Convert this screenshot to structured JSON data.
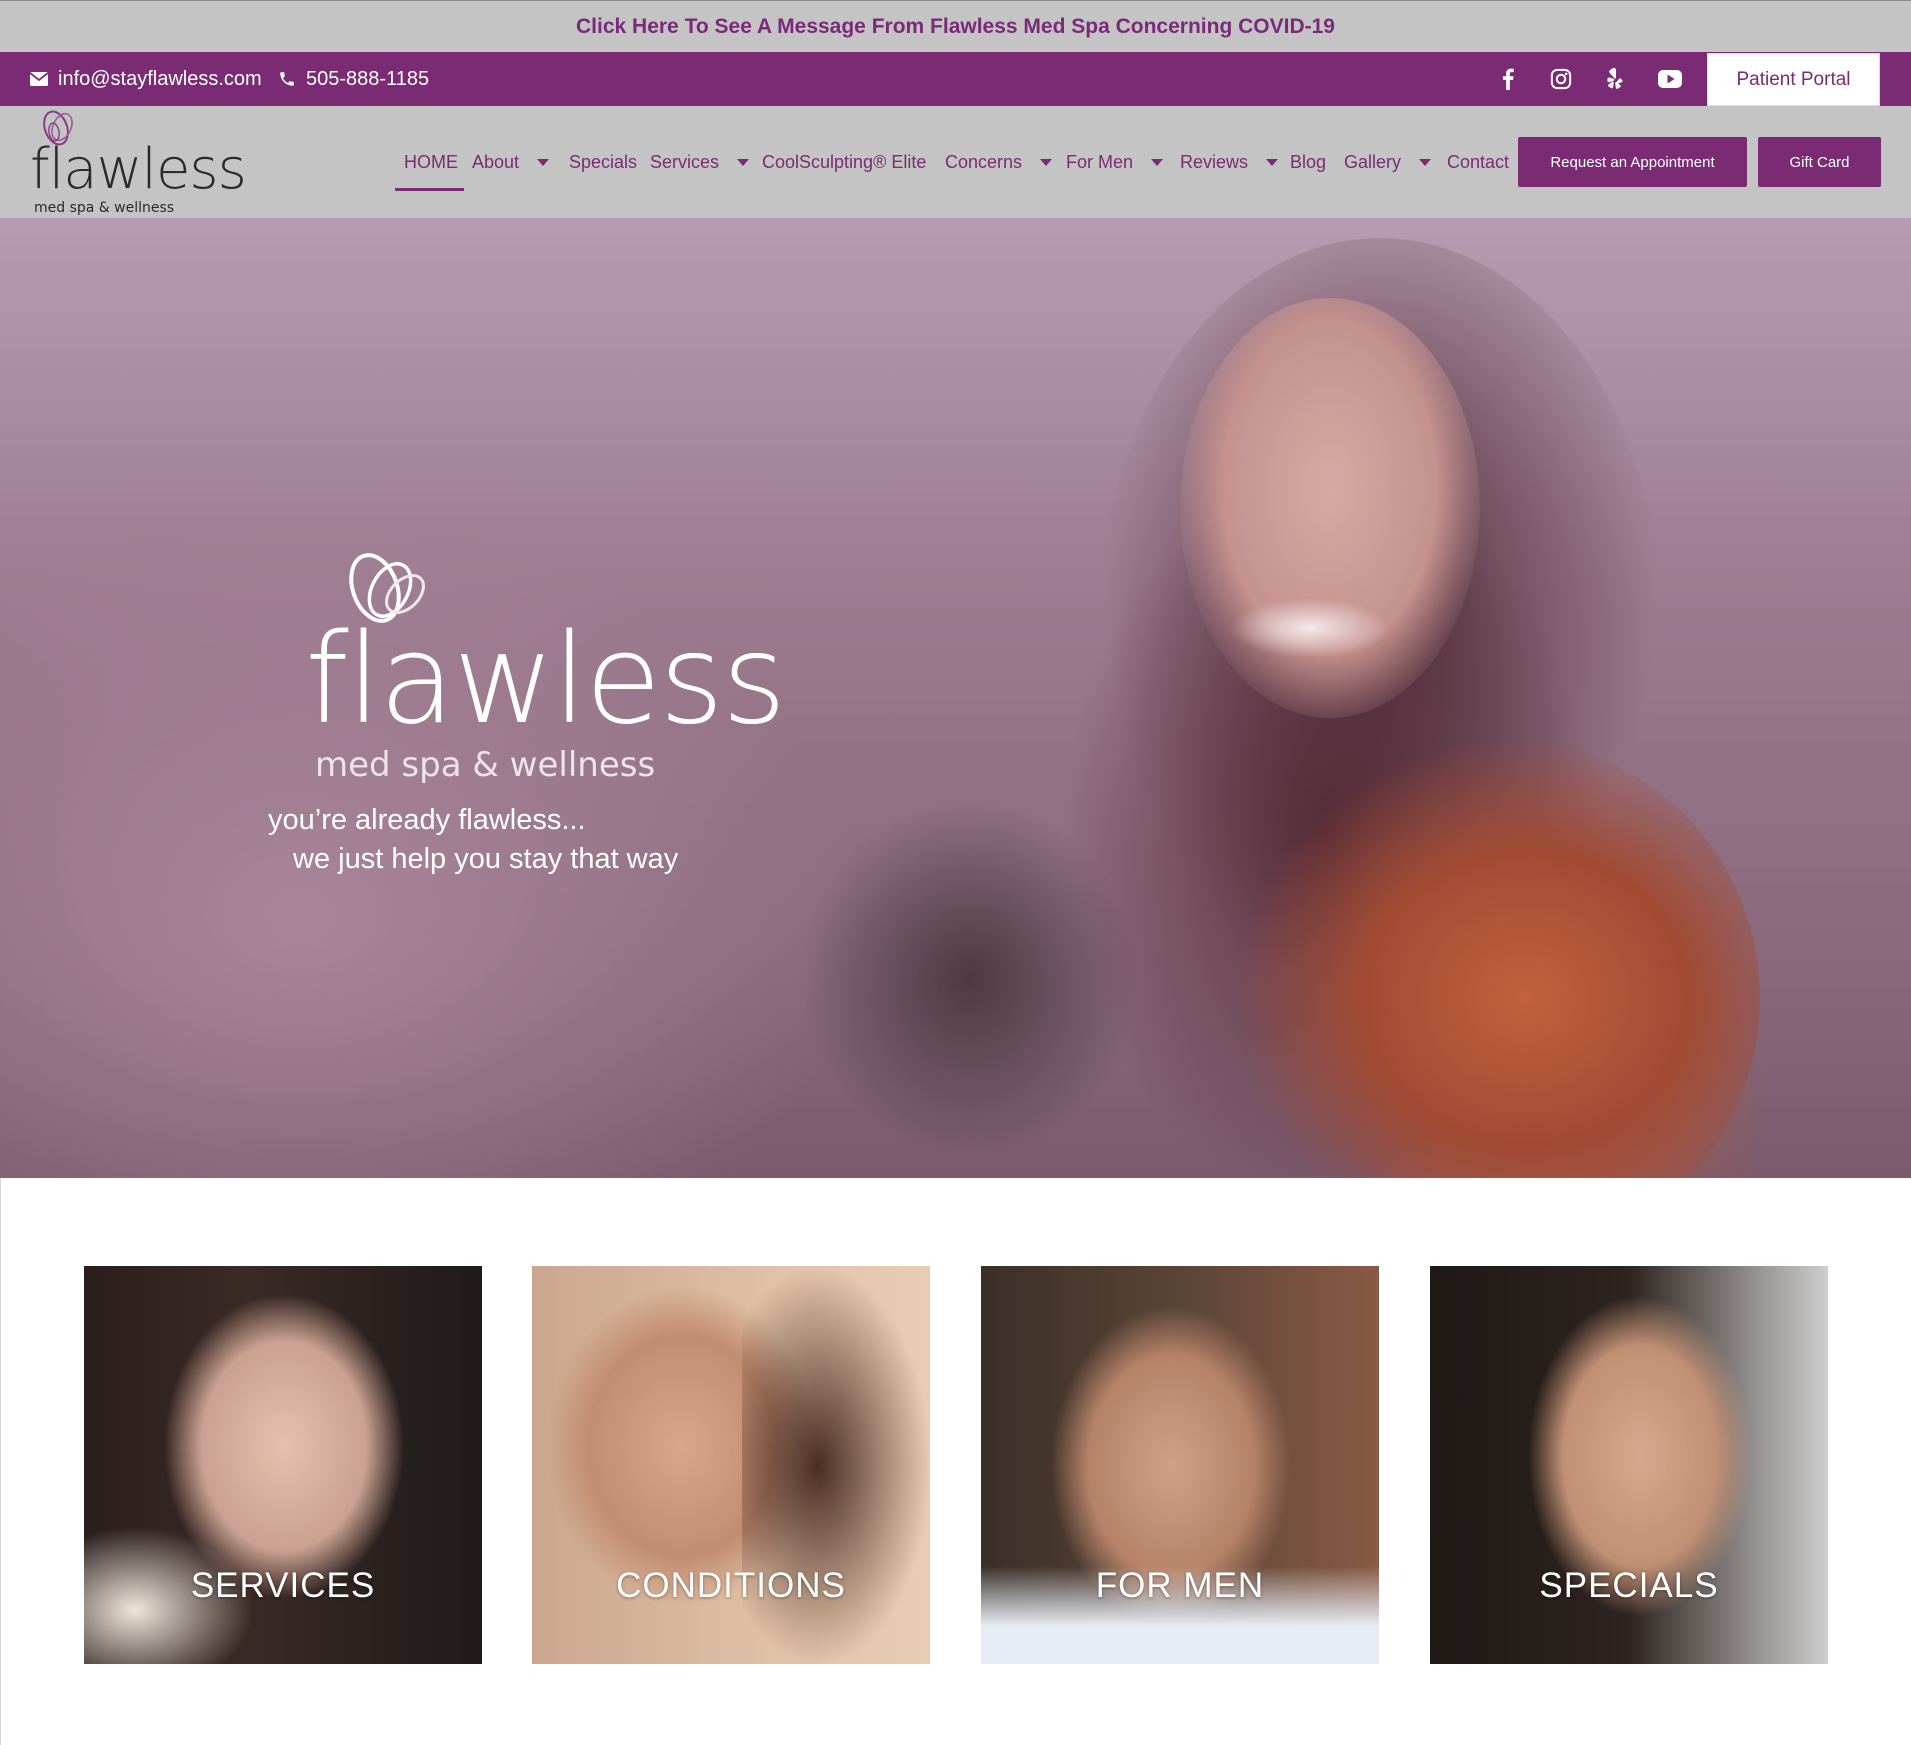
{
  "covid_banner": {
    "text": "Click Here To See A Message From Flawless Med Spa Concerning COVID-19"
  },
  "contact": {
    "email": "info@stayflawless.com",
    "phone": "505-888-1185",
    "email_icon": "envelope-icon",
    "phone_icon": "phone-icon"
  },
  "social": [
    {
      "name": "facebook-icon"
    },
    {
      "name": "instagram-icon"
    },
    {
      "name": "yelp-icon"
    },
    {
      "name": "youtube-icon"
    }
  ],
  "patient_portal": {
    "label": "Patient Portal"
  },
  "logo": {
    "word": "flawless",
    "sub": "med spa & wellness"
  },
  "nav": {
    "items": [
      {
        "label": "HOME",
        "active": true
      },
      {
        "label": "About",
        "dropdown": true
      },
      {
        "label": "Specials"
      },
      {
        "label": "Services",
        "dropdown": true
      },
      {
        "label": "CoolSculpting® Elite"
      },
      {
        "label": "Concerns",
        "dropdown": true
      },
      {
        "label": "For Men",
        "dropdown": true
      },
      {
        "label": "Reviews",
        "dropdown": true
      },
      {
        "label": "Blog"
      },
      {
        "label": "Gallery",
        "dropdown": true
      },
      {
        "label": "Contact"
      }
    ],
    "request_button": "Request an Appointment",
    "gift_button": "Gift Card"
  },
  "hero": {
    "logo_word": "flawless",
    "logo_sub": "med spa & wellness",
    "tagline_1": "you’re already flawless...",
    "tagline_2": "we just help you stay that way"
  },
  "tiles": [
    {
      "label": "SERVICES"
    },
    {
      "label": "CONDITIONS"
    },
    {
      "label": "FOR MEN"
    },
    {
      "label": "SPECIALS"
    }
  ],
  "colors": {
    "brand_purple": "#7a2b73",
    "bar_gray": "#c4c4c4",
    "white": "#ffffff"
  }
}
